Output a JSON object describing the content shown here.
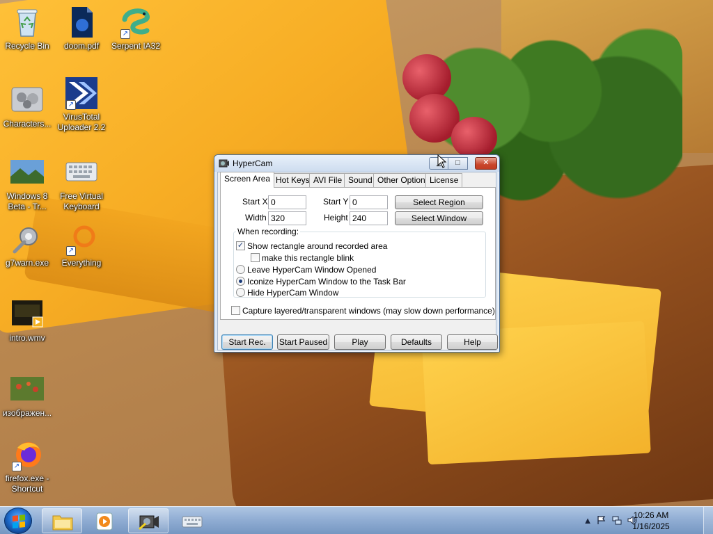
{
  "desktop": {
    "icons": [
      {
        "label": "Recycle Bin",
        "icon": "recycle-bin-icon"
      },
      {
        "label": "doom.pdf",
        "icon": "pdf-file-icon"
      },
      {
        "label": "Serpent IA32",
        "icon": "serpent-icon"
      },
      {
        "label": "Characters...",
        "icon": "characters-icon"
      },
      {
        "label": "VirusTotal Uploader 2.2",
        "icon": "virustotal-icon"
      },
      {
        "label": "Windows 8 Beta - Tr...",
        "icon": "landscape-image-icon"
      },
      {
        "label": "Free Virtual Keyboard",
        "icon": "keyboard-icon"
      },
      {
        "label": "g7warn.exe",
        "icon": "gear-exe-icon"
      },
      {
        "label": "Everything",
        "icon": "everything-search-icon"
      },
      {
        "label": "intro.wmv",
        "icon": "video-file-icon"
      },
      {
        "label": "изображен...",
        "icon": "image-file-icon"
      },
      {
        "label": "firefox.exe - Shortcut",
        "icon": "firefox-icon"
      }
    ]
  },
  "window": {
    "title": "HyperCam",
    "minimize_icon": "minimize-icon",
    "maximize_glyph": "□",
    "close_glyph": "✕",
    "tabs": [
      "Screen Area",
      "Hot Keys",
      "AVI File",
      "Sound",
      "Other Options",
      "License"
    ],
    "active_tab": "Screen Area",
    "start_x_label": "Start X",
    "start_x_value": "0",
    "start_y_label": "Start Y",
    "start_y_value": "0",
    "width_label": "Width",
    "width_value": "320",
    "height_label": "Height",
    "height_value": "240",
    "select_region_label": "Select Region",
    "select_window_label": "Select Window",
    "group_title": "When recording:",
    "show_rect_label": "Show rectangle around recorded area",
    "show_rect_checked": true,
    "blink_label": "make this rectangle blink",
    "blink_checked": false,
    "radio_leave_label": "Leave HyperCam Window Opened",
    "radio_iconize_label": "Iconize HyperCam Window to the Task Bar",
    "radio_hide_label": "Hide HyperCam Window",
    "radio_selected": "iconize",
    "layered_label": "Capture layered/transparent windows (may slow down performance)",
    "layered_checked": false,
    "buttons": {
      "start_rec": "Start Rec.",
      "start_paused": "Start Paused",
      "play": "Play",
      "defaults": "Defaults",
      "help": "Help"
    }
  },
  "taskbar": {
    "items": [
      "file-explorer-icon",
      "media-player-icon",
      "hypercam-icon",
      "on-screen-keyboard-icon"
    ],
    "tray": {
      "show_hidden_glyph": "▲",
      "time": "10:26 AM",
      "date": "1/16/2025"
    }
  },
  "colors": {
    "accent_blue": "#1f6fd1",
    "titlebar": "#cddcef",
    "close_red": "#c9462c"
  }
}
